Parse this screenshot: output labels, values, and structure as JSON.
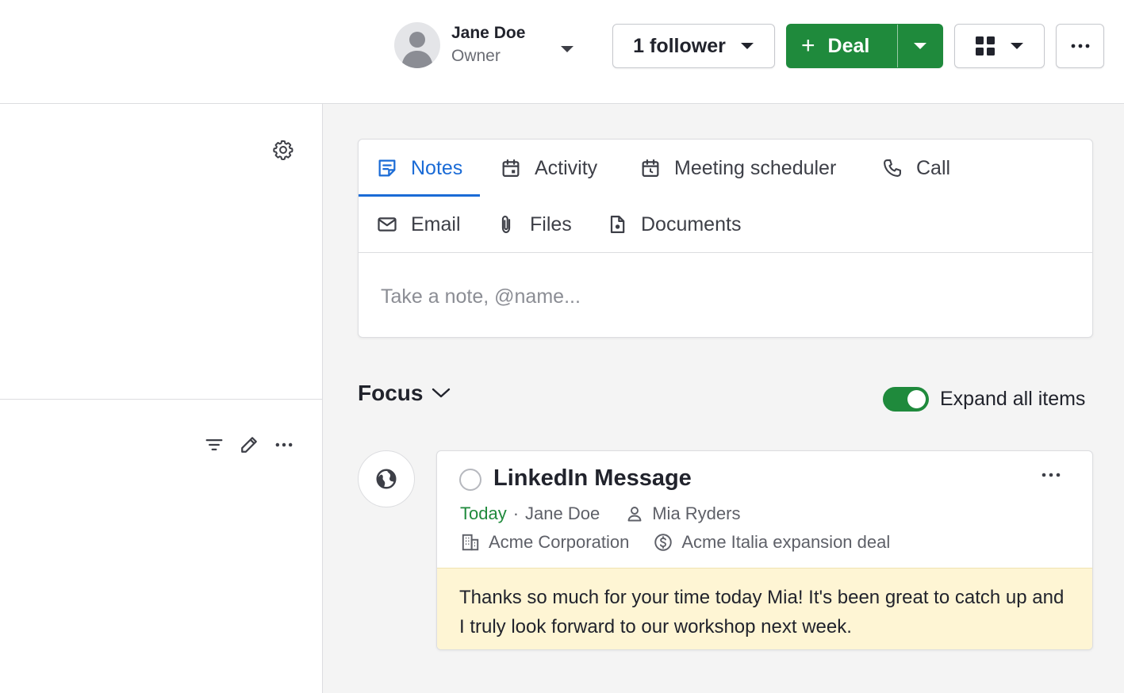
{
  "header": {
    "owner": {
      "name": "Jane Doe",
      "role": "Owner"
    },
    "followers_label": "1 follower",
    "deal_label": "Deal",
    "deal_plus": "+"
  },
  "composer": {
    "tabs": [
      {
        "label": "Notes",
        "icon": "note-icon",
        "active": true
      },
      {
        "label": "Activity",
        "icon": "calendar-icon"
      },
      {
        "label": "Meeting scheduler",
        "icon": "calendar-clock-icon"
      },
      {
        "label": "Call",
        "icon": "phone-icon"
      },
      {
        "label": "Email",
        "icon": "mail-icon"
      },
      {
        "label": "Files",
        "icon": "paperclip-icon"
      },
      {
        "label": "Documents",
        "icon": "document-icon"
      }
    ],
    "placeholder": "Take a note, @name..."
  },
  "feed": {
    "section_label": "Focus",
    "expand_label": "Expand all items",
    "expand_on": true,
    "item": {
      "title": "LinkedIn Message",
      "date": "Today",
      "separator": "·",
      "author": "Jane Doe",
      "person": "Mia Ryders",
      "organization": "Acme Corporation",
      "deal": "Acme Italia expansion deal",
      "note": "Thanks so much for your time today Mia! It's been great to catch up and I truly look forward to our workshop next week."
    }
  },
  "colors": {
    "accent_green": "#1f8a3c",
    "accent_blue": "#1a6bd6",
    "note_background": "#fef5d4"
  }
}
